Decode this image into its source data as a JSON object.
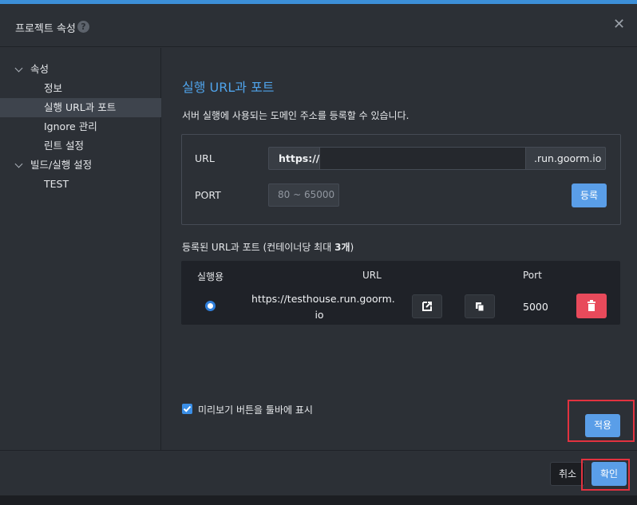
{
  "dialog": {
    "title": "프로젝트 속성",
    "help_icon": "?",
    "close_icon": "✕"
  },
  "sidebar": {
    "groups": [
      {
        "label": "속성",
        "items": [
          "정보",
          "실행 URL과 포트",
          "Ignore 관리",
          "린트 설정"
        ]
      },
      {
        "label": "빌드/실행 설정",
        "items": [
          "TEST"
        ]
      }
    ],
    "selected": "실행 URL과 포트"
  },
  "main": {
    "section_title": "실행 URL과 포트",
    "description": "서버 실행에 사용되는 도메인 주소를 등록할 수 있습니다.",
    "form": {
      "url_label": "URL",
      "url_prefix": "https://",
      "url_value": "",
      "url_suffix": ".run.goorm.io",
      "port_label": "PORT",
      "port_placeholder": "80 ~ 65000",
      "register_label": "등록"
    },
    "list_title_prefix": "등록된 URL과 포트 (컨테이너당 최대 ",
    "list_title_count": "3개",
    "list_title_suffix": ")",
    "table": {
      "headers": [
        "실행용",
        "URL",
        "Port"
      ],
      "rows": [
        {
          "url_line1": "https://testhouse.run.goorm.",
          "url_line2": "io",
          "port": "5000",
          "selected": true
        }
      ]
    },
    "checkbox_label": "미리보기 버튼을 툴바에 표시",
    "checkbox_checked": true,
    "apply_label": "적용"
  },
  "footer": {
    "cancel_label": "취소",
    "ok_label": "확인"
  },
  "colors": {
    "accent": "#5a9ee8",
    "title_blue": "#4fa3ea",
    "danger": "#e84a5b",
    "highlight": "#e3323f"
  }
}
